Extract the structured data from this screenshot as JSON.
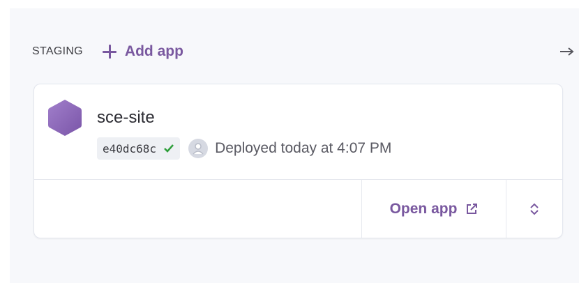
{
  "pipeline": {
    "stage_label": "STAGING",
    "add_app_label": "Add app"
  },
  "app": {
    "name": "sce-site",
    "commit": "e40dc68c",
    "deploy_status": "Deployed today at 4:07 PM",
    "open_app_label": "Open app"
  },
  "colors": {
    "accent": "#79589f",
    "success": "#2e9e3a",
    "hexagon": "#8c65b8"
  },
  "icons": {
    "add": "plus-icon",
    "stage_arrow": "arrow-right-icon",
    "app": "hexagon-app-icon",
    "commit_ok": "check-icon",
    "user": "avatar-icon",
    "external": "external-link-icon",
    "menu": "chevron-up-down-icon"
  }
}
